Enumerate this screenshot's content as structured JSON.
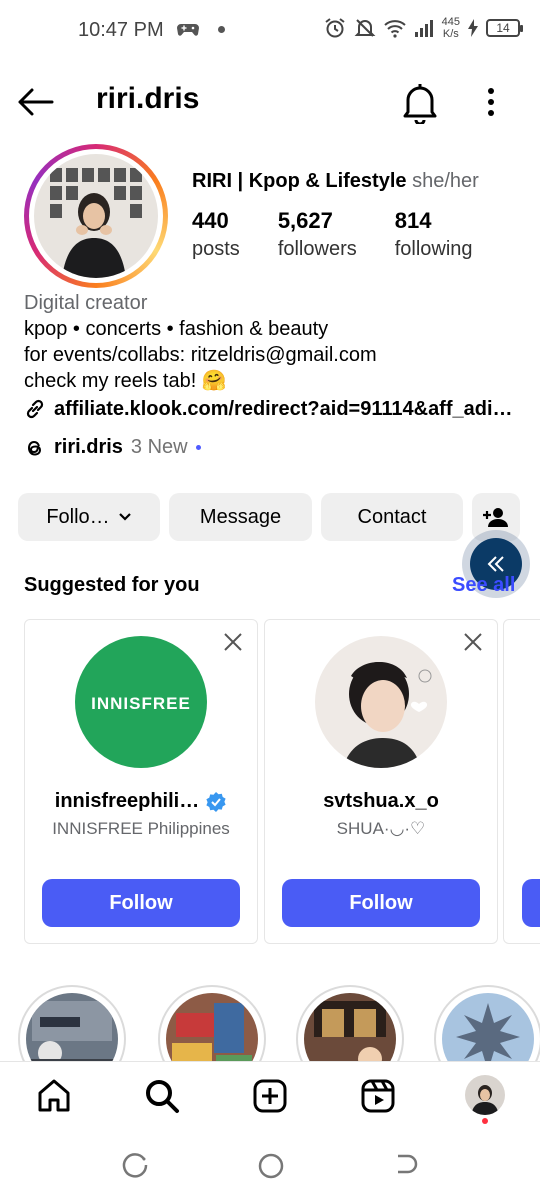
{
  "status": {
    "time": "10:47 PM",
    "net_speed_value": "445",
    "net_speed_unit": "K/s",
    "battery": "14"
  },
  "header": {
    "username": "riri.dris"
  },
  "profile": {
    "display_name": "RIRI | Kpop & Lifestyle",
    "pronouns": "she/her",
    "stats": [
      {
        "value": "440",
        "label": "posts"
      },
      {
        "value": "5,627",
        "label": "followers"
      },
      {
        "value": "814",
        "label": "following"
      }
    ],
    "category": "Digital creator",
    "bio_lines": [
      "kpop • concerts • fashion & beauty",
      "for events/collabs: ritzeldris@gmail.com",
      "check my reels tab! 🤗"
    ],
    "link": "affiliate.klook.com/redirect?aid=91114&aff_adi…",
    "threads_name": "riri.dris",
    "threads_new": "3 New"
  },
  "actions": {
    "follow_label": "Follo…",
    "message_label": "Message",
    "contact_label": "Contact"
  },
  "suggested": {
    "title": "Suggested for you",
    "see_all": "See all",
    "cards": [
      {
        "name": "innisfreephili…",
        "sub": "INNISFREE Philippines",
        "button": "Follow",
        "logo_text": "innisfree",
        "verified": true
      },
      {
        "name": "svtshua.x_o",
        "sub": "SHUA·◡·♡",
        "button": "Follow",
        "verified": false
      }
    ]
  },
  "colors": {
    "accent_blue": "#4a5cf5",
    "see_all_blue": "#3b4cff",
    "innisfree_green": "#22a55a"
  },
  "nav": [
    "home-icon",
    "search-icon",
    "create-icon",
    "reels-icon",
    "profile-avatar"
  ]
}
